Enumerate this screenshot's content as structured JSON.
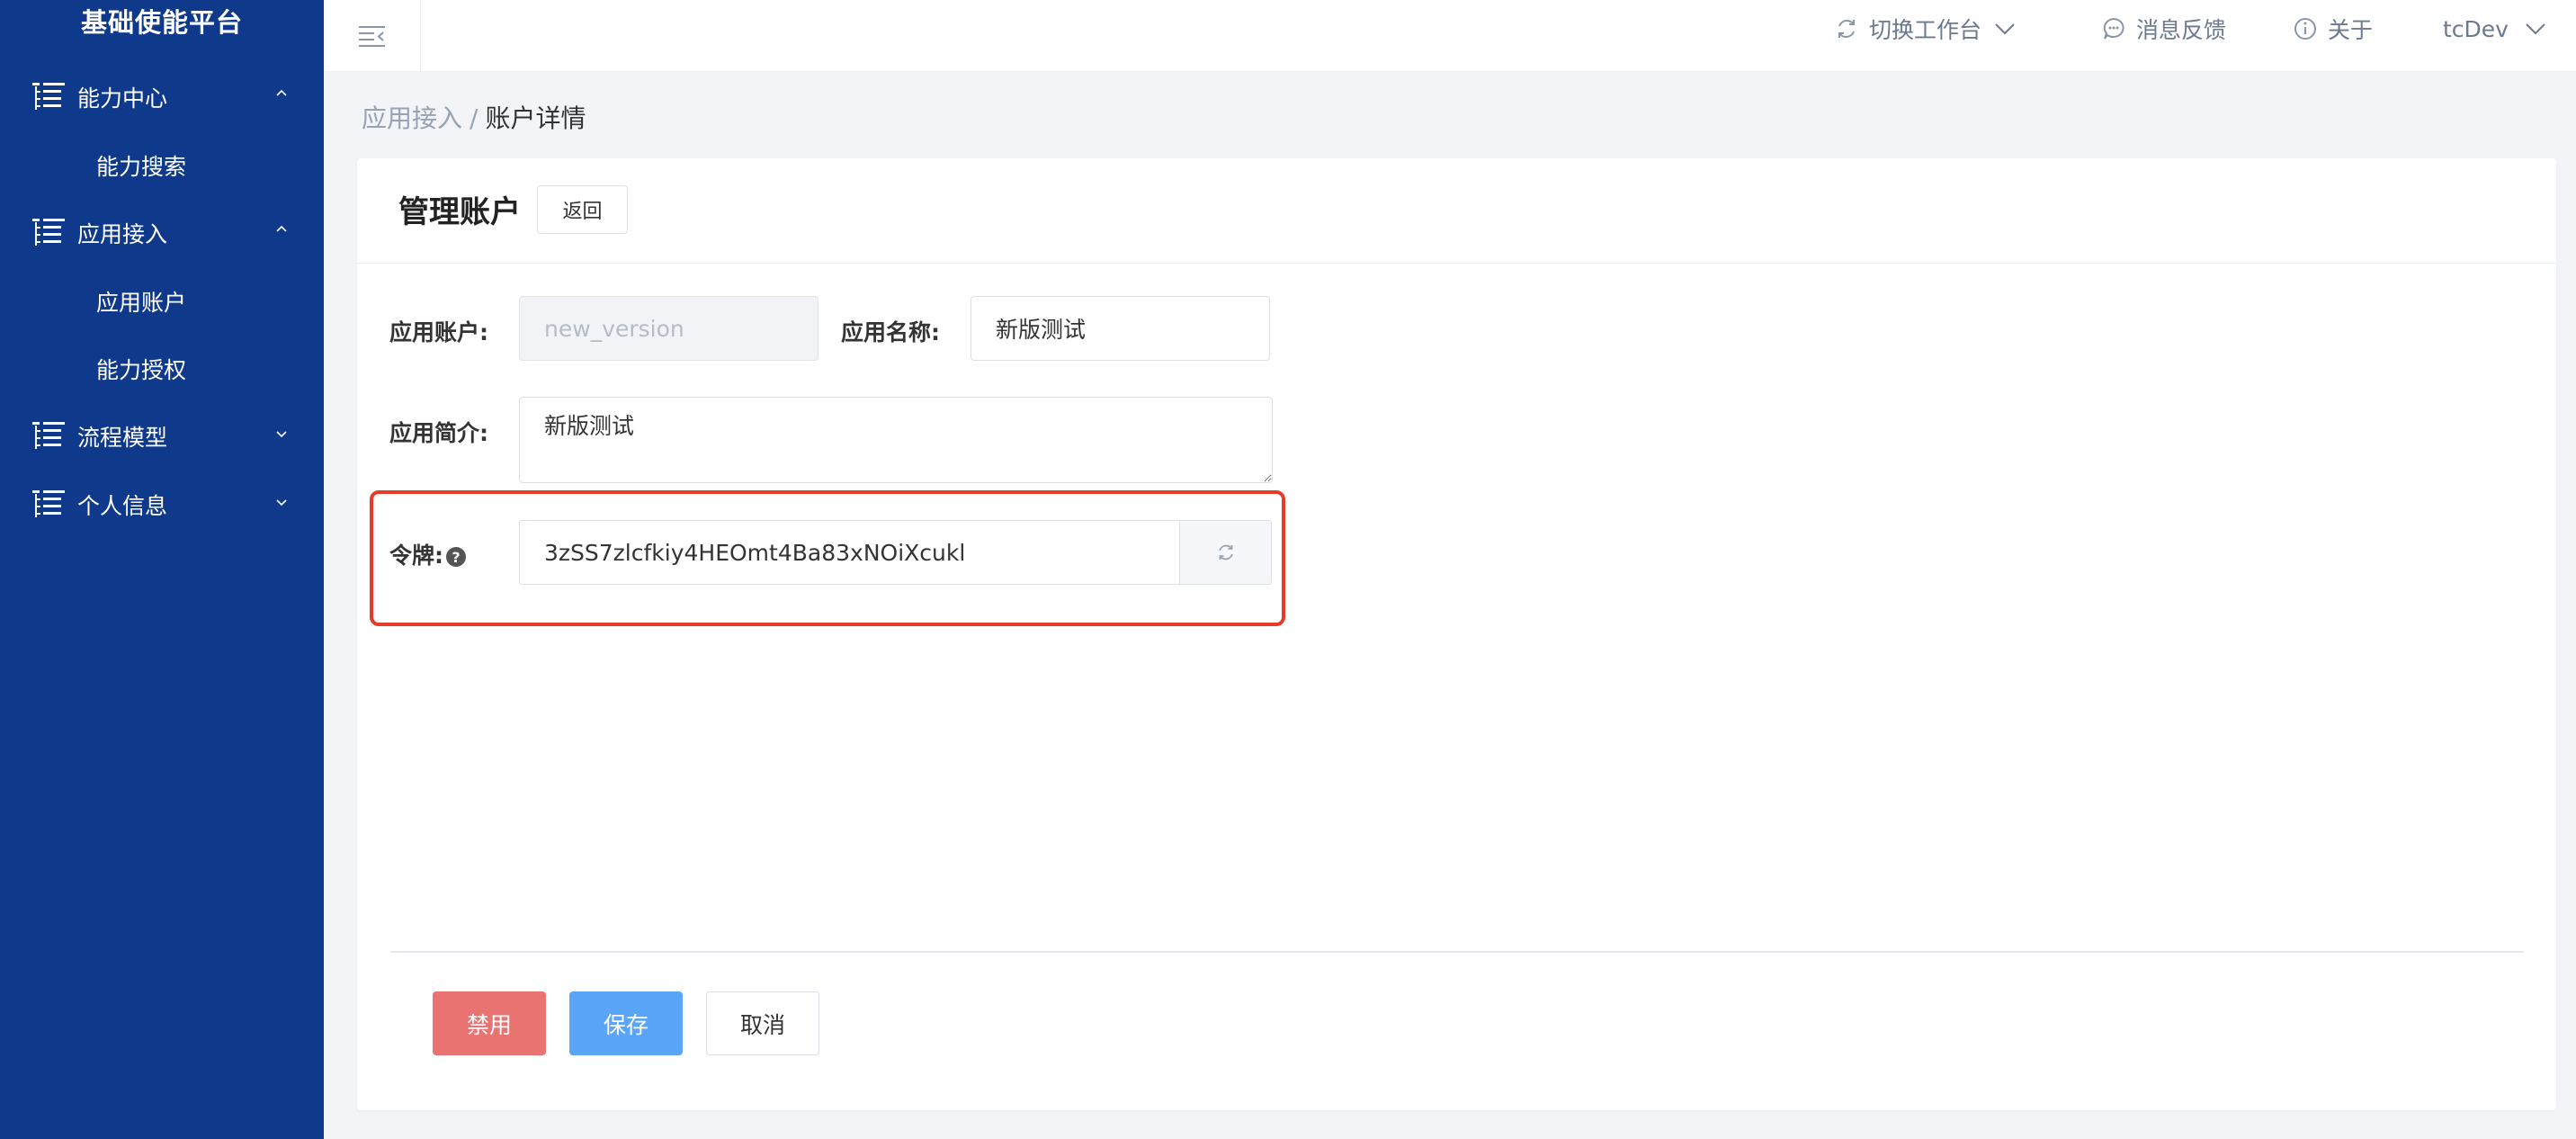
{
  "sidebar": {
    "brand": "基础使能平台",
    "menus": [
      {
        "label": "能力中心",
        "expanded": true,
        "children": [
          "能力搜索"
        ]
      },
      {
        "label": "应用接入",
        "expanded": true,
        "children": [
          "应用账户",
          "能力授权"
        ]
      },
      {
        "label": "流程模型",
        "expanded": false,
        "children": []
      },
      {
        "label": "个人信息",
        "expanded": false,
        "children": []
      }
    ]
  },
  "header": {
    "switch_workspace": "切换工作台",
    "feedback": "消息反馈",
    "about": "关于",
    "user": "tcDev"
  },
  "breadcrumb": {
    "parent": "应用接入",
    "separator": "/",
    "current": "账户详情"
  },
  "card": {
    "title": "管理账户",
    "back_label": "返回"
  },
  "form": {
    "account_label": "应用账户:",
    "account_placeholder": "new_version",
    "name_label": "应用名称:",
    "name_value": "新版测试",
    "intro_label": "应用简介:",
    "intro_value": "新版测试",
    "token_label": "令牌:",
    "token_help": "?",
    "token_value": "3zSS7zlcfkiy4HEOmt4Ba83xNOiXcukl"
  },
  "actions": {
    "disable_label": "禁用",
    "save_label": "保存",
    "cancel_label": "取消"
  },
  "colors": {
    "sidebar_bg": "#0f3a8c",
    "highlight": "#e63a2a",
    "danger": "#e87370",
    "primary": "#5aa5f7"
  }
}
